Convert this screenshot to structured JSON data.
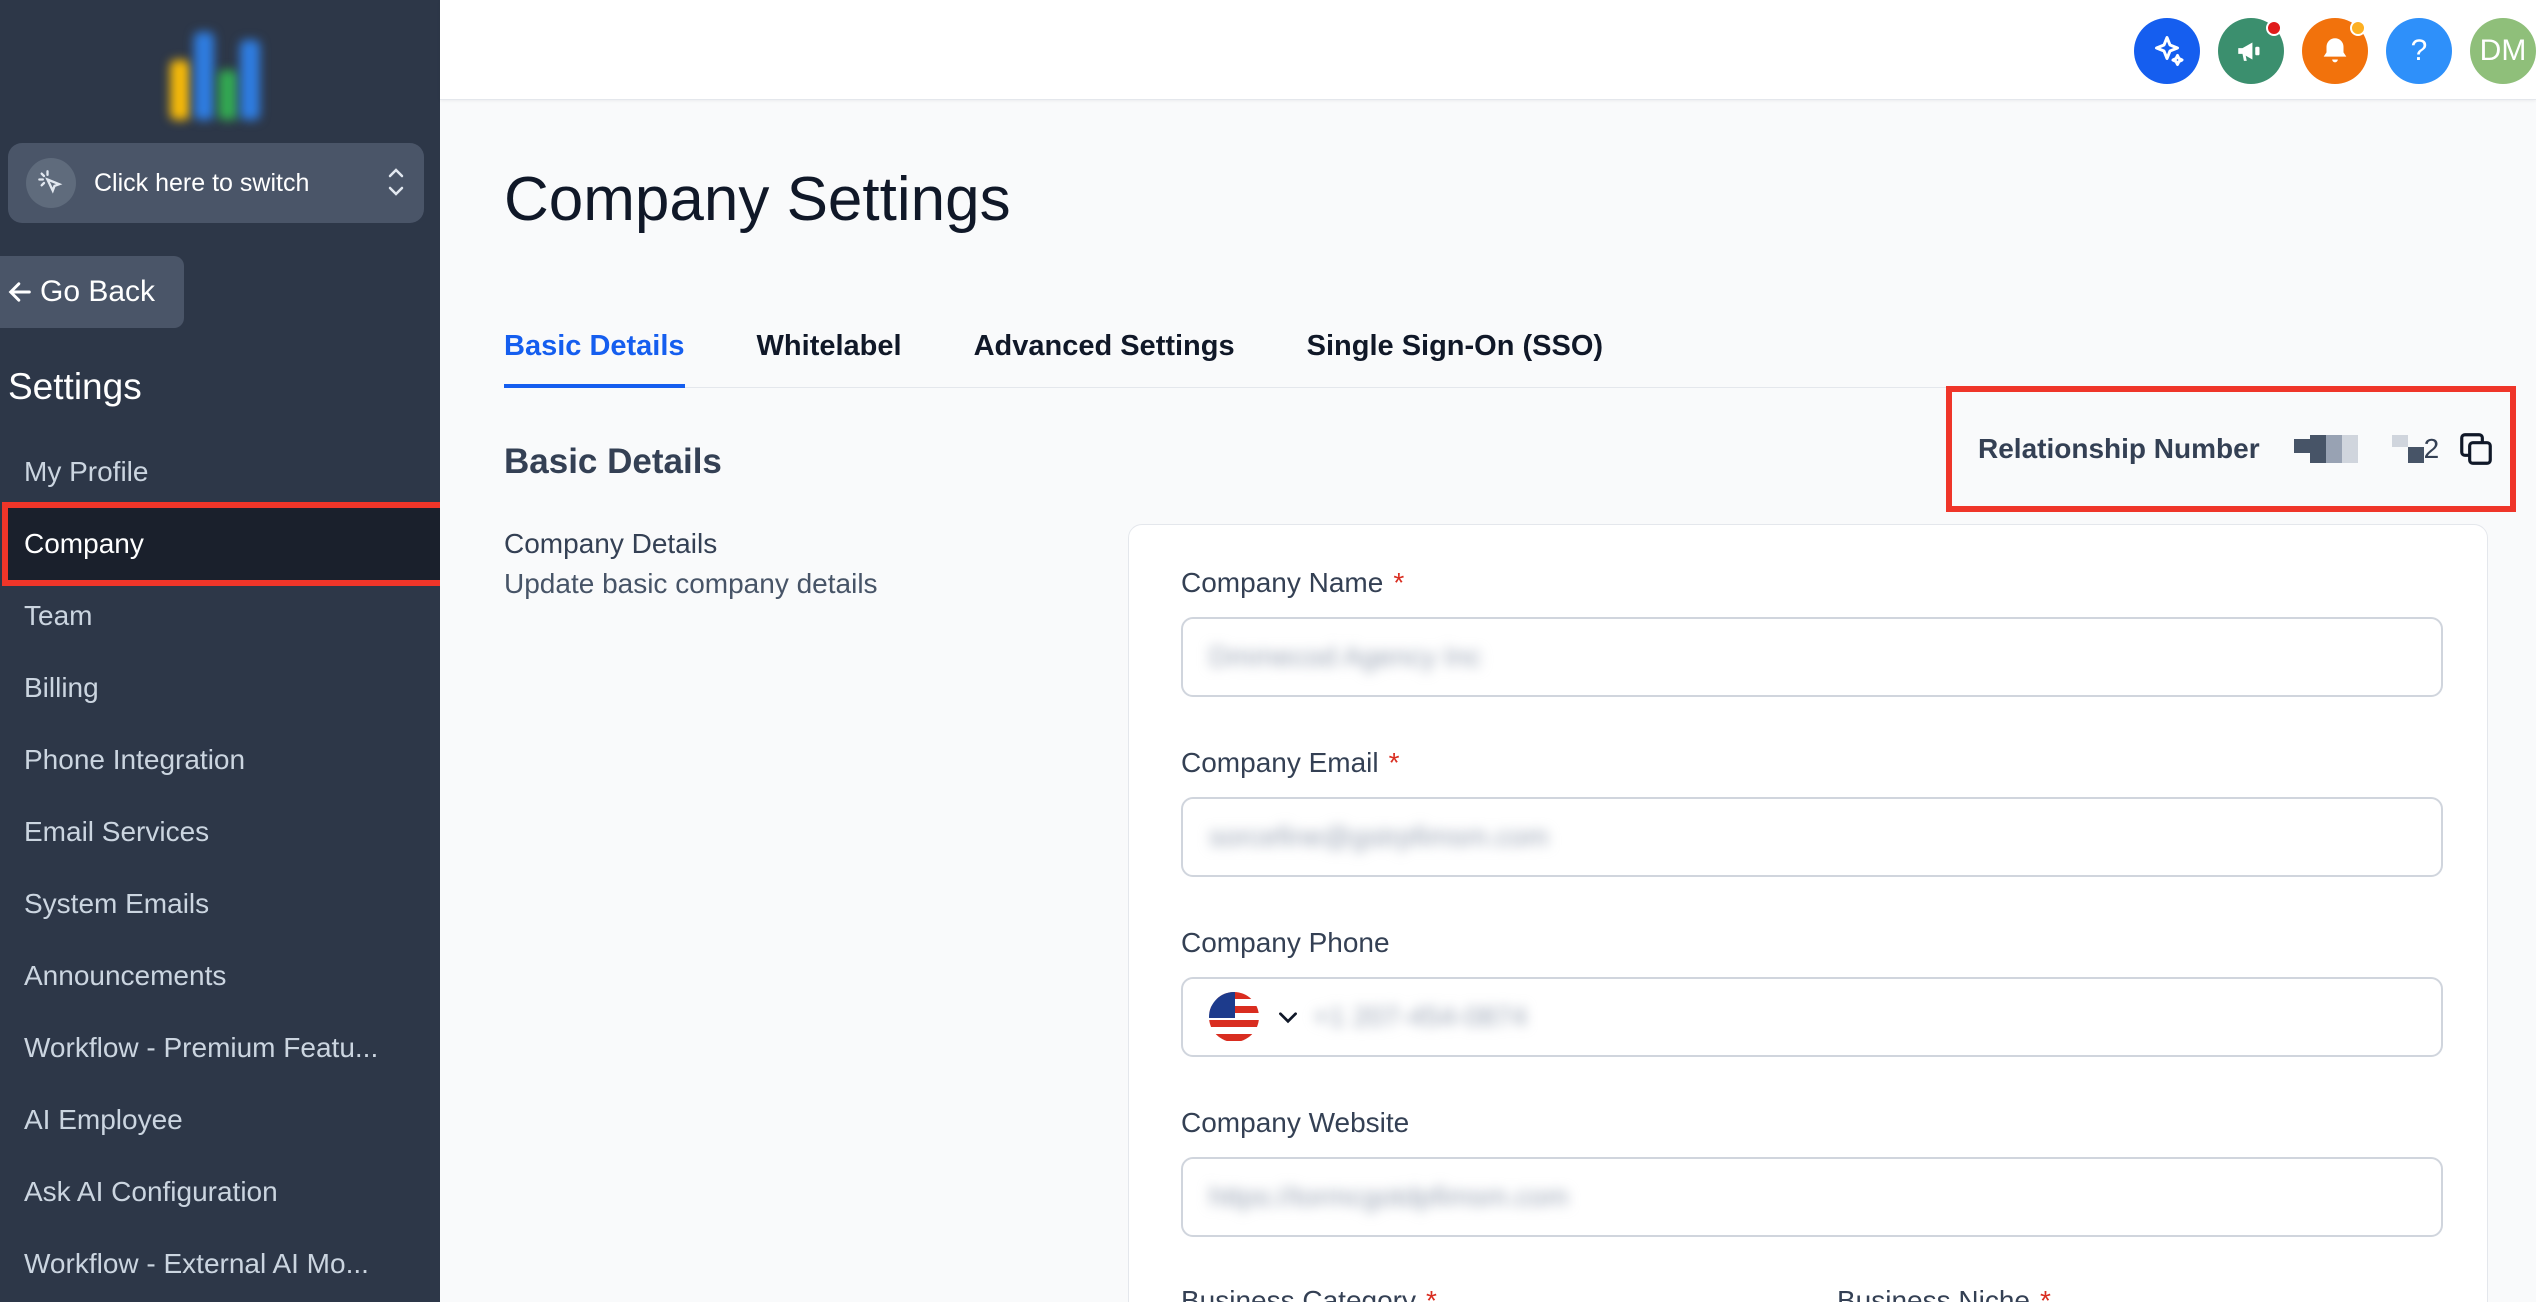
{
  "sidebar": {
    "switcher_label": "Click here to switch",
    "go_back": "Go Back",
    "settings_heading": "Settings",
    "items": [
      {
        "label": "My Profile"
      },
      {
        "label": "Company",
        "active": true
      },
      {
        "label": "Team"
      },
      {
        "label": "Billing"
      },
      {
        "label": "Phone Integration"
      },
      {
        "label": "Email Services"
      },
      {
        "label": "System Emails"
      },
      {
        "label": "Announcements"
      },
      {
        "label": "Workflow - Premium Featu..."
      },
      {
        "label": "AI Employee"
      },
      {
        "label": "Ask AI Configuration"
      },
      {
        "label": "Workflow - External AI Mo..."
      }
    ]
  },
  "header": {
    "icons": [
      {
        "name": "sparkle-icon",
        "color": "#155eef"
      },
      {
        "name": "megaphone-icon",
        "color": "#3b8f6e",
        "badge": "#e01b1b"
      },
      {
        "name": "bell-icon",
        "color": "#f2720c",
        "badge": "#fdb022"
      },
      {
        "name": "help-icon",
        "color": "#2e90fa"
      },
      {
        "name": "avatar",
        "color": "#8fbf7a"
      }
    ],
    "help_glyph": "?",
    "avatar_initials": "DM"
  },
  "page": {
    "title": "Company Settings",
    "tabs": [
      "Basic Details",
      "Whitelabel",
      "Advanced Settings",
      "Single Sign-On (SSO)"
    ],
    "active_tab": "Basic Details"
  },
  "section": {
    "title": "Basic Details",
    "subtitle_heading": "Company Details",
    "subtitle_text": "Update basic company details"
  },
  "relationship": {
    "label": "Relationship Number",
    "value_suffix": "2"
  },
  "form": {
    "company_name": {
      "label": "Company Name",
      "required": "*",
      "value": "Dmmecod Agency Inc"
    },
    "company_email": {
      "label": "Company Email",
      "required": "*",
      "value": "sorcefine@gstrpfimsm.com"
    },
    "company_phone": {
      "label": "Company Phone",
      "value": "+1 207-454-0874"
    },
    "company_website": {
      "label": "Company Website",
      "value": "https://tormcgotdpfimsm.com"
    },
    "business_category": {
      "label": "Business Category",
      "required": "*"
    },
    "business_niche": {
      "label": "Business Niche",
      "required": "*"
    }
  },
  "colors": {
    "accent": "#155eef",
    "highlight_box": "#ef3529",
    "sidebar_bg": "#2d3748"
  }
}
